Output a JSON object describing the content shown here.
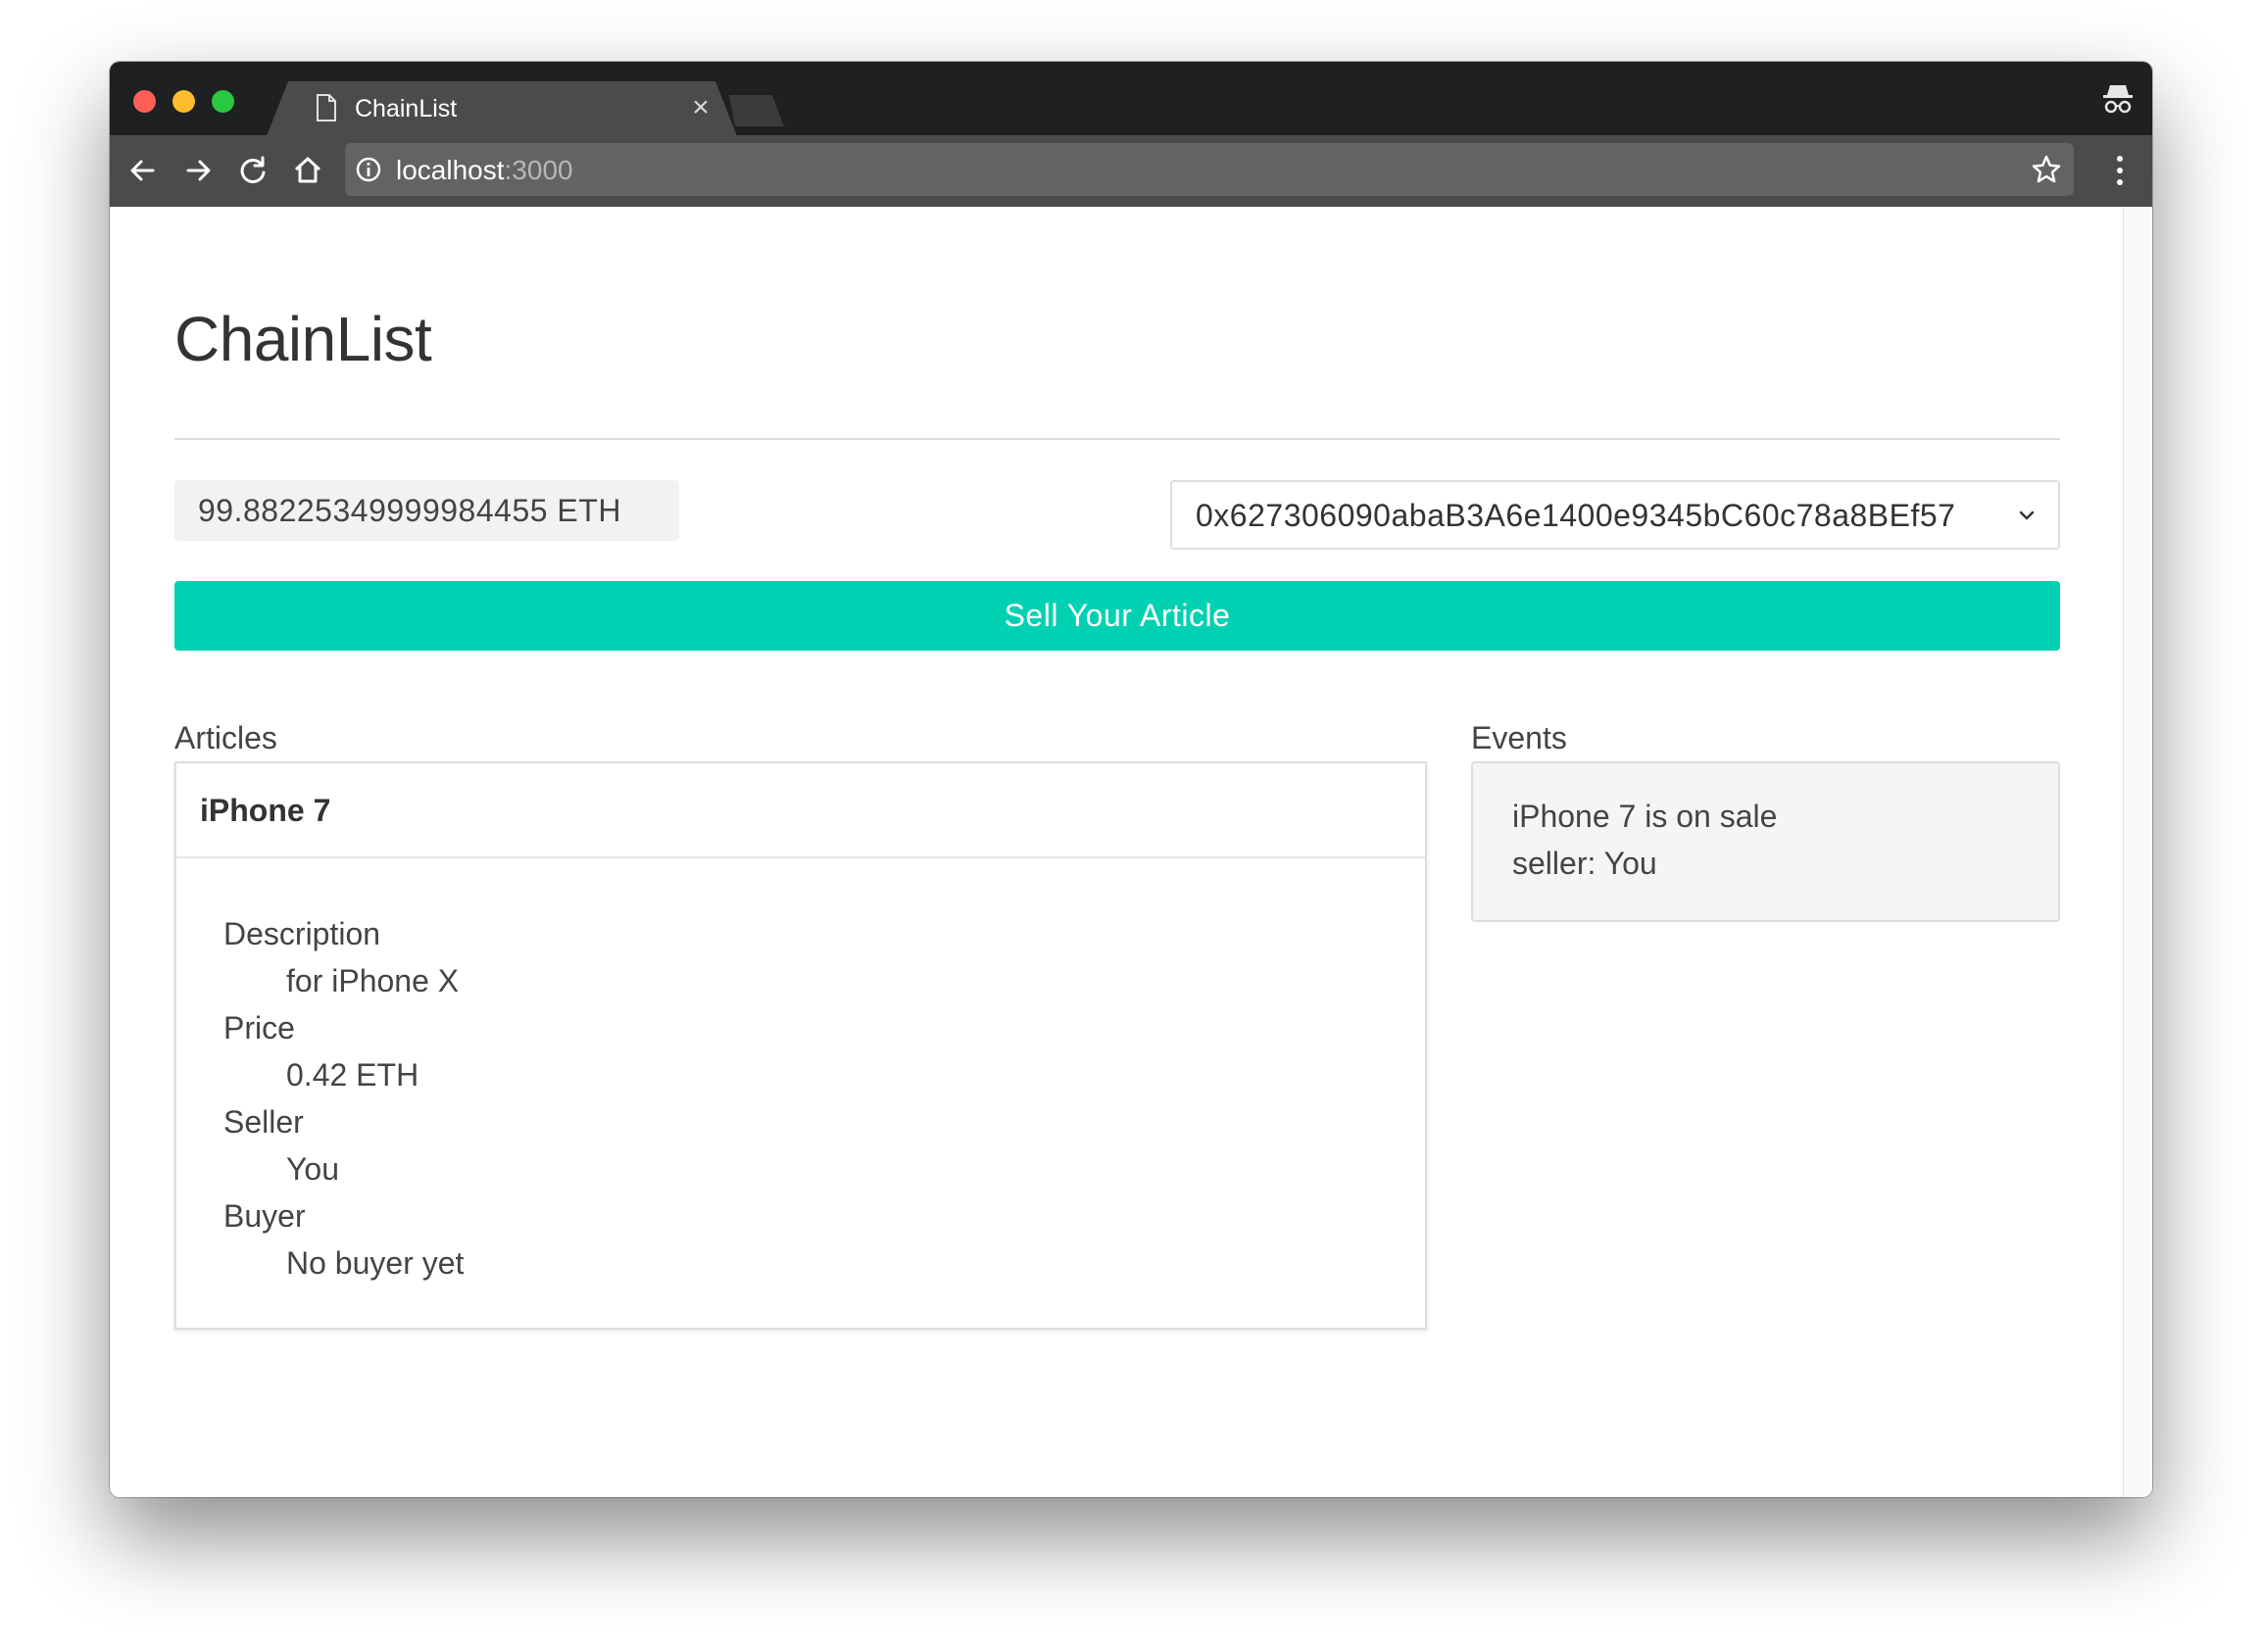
{
  "browser": {
    "tab_title": "ChainList",
    "tab_close_glyph": "×",
    "url_host": "localhost",
    "url_port": ":3000"
  },
  "page": {
    "title": "ChainList",
    "balance": "99.88225349999984455 ETH",
    "account": "0x627306090abaB3A6e1400e9345bC60c78a8BEf57",
    "sell_button_label": "Sell Your Article",
    "articles_label": "Articles",
    "events_label": "Events"
  },
  "article": {
    "name": "iPhone 7",
    "description_label": "Description",
    "description": "for iPhone X",
    "price_label": "Price",
    "price": "0.42 ETH",
    "seller_label": "Seller",
    "seller": "You",
    "buyer_label": "Buyer",
    "buyer": "No buyer yet"
  },
  "events": [
    "iPhone 7 is on sale",
    "seller: You"
  ],
  "colors": {
    "accent": "#00d1b2",
    "titlebar": "#1f2022",
    "toolbar": "#4a4b4d",
    "omnibox": "#636364",
    "traffic_red": "#fe5f57",
    "traffic_yellow": "#febc2e",
    "traffic_green": "#28c840"
  },
  "icons": [
    "file-icon",
    "incognito-icon",
    "back-arrow-icon",
    "forward-arrow-icon",
    "reload-icon",
    "home-icon",
    "info-icon",
    "star-icon",
    "more-vertical-icon",
    "chevron-down-icon"
  ]
}
